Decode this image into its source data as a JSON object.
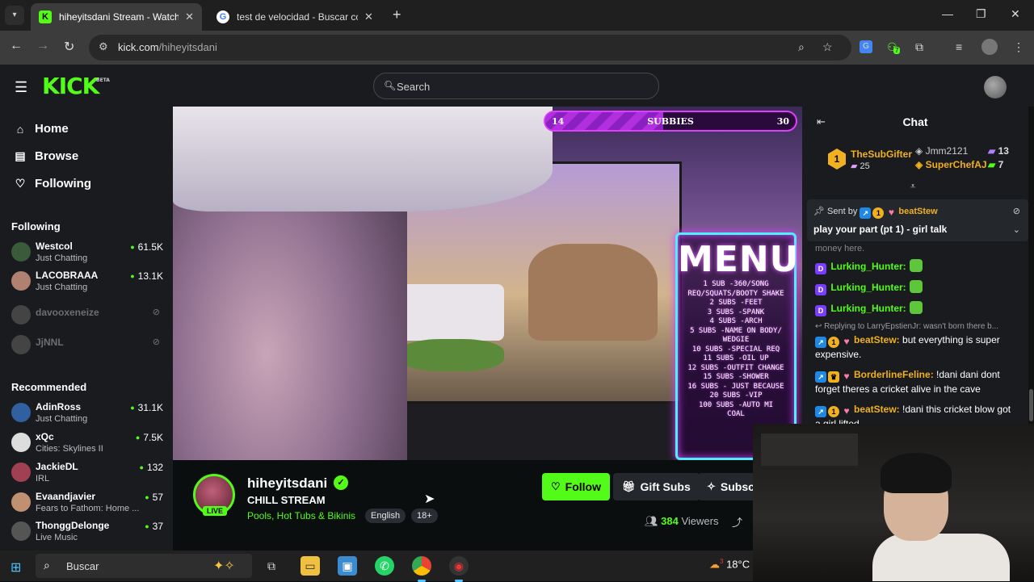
{
  "browser": {
    "tabs": [
      {
        "title": "hiheyitsdani Stream - Watch Live",
        "favicon": "K",
        "active": true
      },
      {
        "title": "test de velocidad - Buscar con G",
        "favicon": "G",
        "active": false
      }
    ],
    "url_domain": "kick.com",
    "url_path": "/hiheyitsdani",
    "extension_badge": "7"
  },
  "header": {
    "logo": "KICK",
    "logo_tag": "BETA",
    "search_placeholder": "Search"
  },
  "sidebar": {
    "nav": [
      {
        "label": "Home",
        "icon": "home-icon"
      },
      {
        "label": "Browse",
        "icon": "browse-icon"
      },
      {
        "label": "Following",
        "icon": "heart-icon"
      }
    ],
    "following_title": "Following",
    "following": [
      {
        "name": "Westcol",
        "category": "Just Chatting",
        "viewers": "61.5K"
      },
      {
        "name": "LACOBRAAA",
        "category": "Just Chatting",
        "viewers": "13.1K"
      },
      {
        "name": "davooxeneize",
        "offline": true
      },
      {
        "name": "JjNNL",
        "offline": true
      }
    ],
    "recommended_title": "Recommended",
    "recommended": [
      {
        "name": "AdinRoss",
        "category": "Just Chatting",
        "viewers": "31.1K"
      },
      {
        "name": "xQc",
        "category": "Cities: Skylines II",
        "viewers": "7.5K"
      },
      {
        "name": "JackieDL",
        "category": "IRL",
        "viewers": "132"
      },
      {
        "name": "Evaandjavier",
        "category": "Fears to Fathom: Home ...",
        "viewers": "57"
      },
      {
        "name": "ThonggDelonge",
        "category": "Live Music",
        "viewers": "37"
      }
    ]
  },
  "video": {
    "goal_current": "14",
    "goal_label": "SUBBIES",
    "goal_target": "30",
    "goal_progress": 0.47,
    "menu_title": "MENU",
    "menu_lines": [
      "1 SUB -360/SONG",
      "REQ/SQUATS/BOOTY SHAKE",
      "2 SUBS -FEET",
      "3 SUBS -SPANK",
      "4 SUBS -ARCH",
      "5 SUBS -NAME ON BODY/",
      "WEDGIE",
      "10 SUBS -SPECIAL REQ",
      "11 SUBS -OIL UP",
      "12 SUBS -OUTFIT CHANGE",
      "15 SUBS -SHOWER",
      "16 SUBS - JUST BECAUSE",
      "20 SUBS -VIP",
      "100 SUBS -AUTO MI",
      "COAL"
    ]
  },
  "stream": {
    "live_badge": "LIVE",
    "name": "hiheyitsdani",
    "title": "CHILL STREAM",
    "category": "Pools, Hot Tubs & Bikinis",
    "tags": [
      "English",
      "18+"
    ],
    "follow_label": "Follow",
    "gift_label": "Gift Subs",
    "subscribe_label": "Subscribe",
    "viewers_count": "384",
    "viewers_label": "Viewers"
  },
  "chat": {
    "title": "Chat",
    "top_gifter": {
      "rank": "1",
      "name": "TheSubGifter",
      "count": "25"
    },
    "gifters": [
      {
        "name": "Jmm2121",
        "count": "13"
      },
      {
        "name": "SuperChefAJ",
        "count": "7"
      }
    ],
    "pinned_sent_by": "Sent by",
    "pinned_user": "beatStew",
    "pinned_text": "play your part (pt 1) - girl talk",
    "peek_text": "money here.",
    "messages": [
      {
        "user": "Lurking_Hunter:",
        "text": ""
      },
      {
        "user": "Lurking_Hunter:",
        "text": ""
      },
      {
        "user": "Lurking_Hunter:",
        "text": ""
      }
    ],
    "reply_note": "Replying to LarryEpstienJr: wasn't born there b...",
    "msg_a_user": "beatStew:",
    "msg_a_text": "but everything is super expensive.",
    "msg_b_user": "BorderlineFeline:",
    "msg_b_text": "!dani dani dont forget theres a cricket alive in the cave",
    "msg_c_user": "beatStew:",
    "msg_c_text": "!dani this cricket blow got a girl lifted"
  },
  "taskbar": {
    "search_placeholder": "Buscar",
    "weather": "18°C",
    "weather_badge": "3"
  },
  "colors": {
    "kick_green": "#53fc18",
    "gold": "#f0b020",
    "purple": "#7a3cff"
  }
}
